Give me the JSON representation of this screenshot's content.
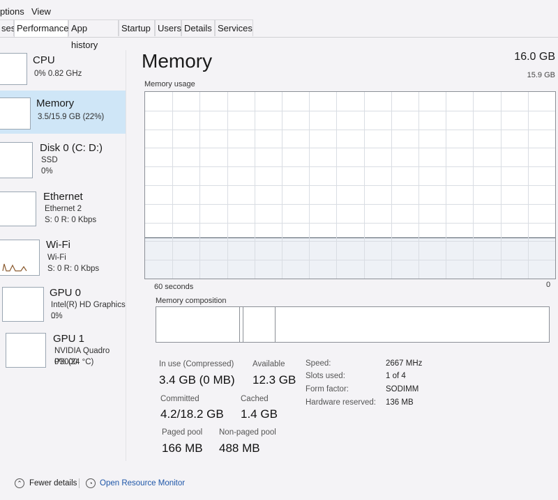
{
  "menu": {
    "options": "ptions",
    "view": "View"
  },
  "tabs": [
    {
      "label": "ses"
    },
    {
      "label": "Performance"
    },
    {
      "label": "App history"
    },
    {
      "label": "Startup"
    },
    {
      "label": "Users"
    },
    {
      "label": "Details"
    },
    {
      "label": "Services"
    }
  ],
  "sidebar": {
    "items": [
      {
        "title": "CPU",
        "sub1": "0% 0.82 GHz",
        "sub2": ""
      },
      {
        "title": "Memory",
        "sub1": "3.5/15.9 GB (22%)",
        "sub2": ""
      },
      {
        "title": "Disk 0 (C: D:)",
        "sub1": "SSD",
        "sub2": "0%"
      },
      {
        "title": "Ethernet",
        "sub1": "Ethernet 2",
        "sub2": "S: 0 R: 0 Kbps"
      },
      {
        "title": "Wi-Fi",
        "sub1": "Wi-Fi",
        "sub2": "S: 0 R: 0 Kbps"
      },
      {
        "title": "GPU 0",
        "sub1": "Intel(R) HD Graphics ...",
        "sub2": "0%"
      },
      {
        "title": "GPU 1",
        "sub1": "NVIDIA Quadro P3000",
        "sub2": "0% (24 °C)"
      }
    ]
  },
  "main": {
    "title": "Memory",
    "total": "16.0 GB",
    "graph_max": "15.9 GB",
    "usage_label": "Memory usage",
    "time_label": "60 seconds",
    "min_label": "0",
    "usage_fraction": 0.22,
    "composition_label": "Memory composition"
  },
  "stats": {
    "in_use_label": "In use (Compressed)",
    "in_use_value": "3.4 GB (0 MB)",
    "available_label": "Available",
    "available_value": "12.3 GB",
    "committed_label": "Committed",
    "committed_value": "4.2/18.2 GB",
    "cached_label": "Cached",
    "cached_value": "1.4 GB",
    "paged_label": "Paged pool",
    "paged_value": "166 MB",
    "nonpaged_label": "Non-paged pool",
    "nonpaged_value": "488 MB"
  },
  "specs": [
    {
      "label": "Speed:",
      "value": "2667 MHz"
    },
    {
      "label": "Slots used:",
      "value": "1 of 4"
    },
    {
      "label": "Form factor:",
      "value": "SODIMM"
    },
    {
      "label": "Hardware reserved:",
      "value": "136 MB"
    }
  ],
  "footer": {
    "fewer_details": "Fewer details",
    "open_monitor": "Open Resource Monitor"
  },
  "colors": {
    "selected_bg": "#cfe6f7",
    "link": "#1e56a8",
    "graph_border": "#8b8f96"
  }
}
